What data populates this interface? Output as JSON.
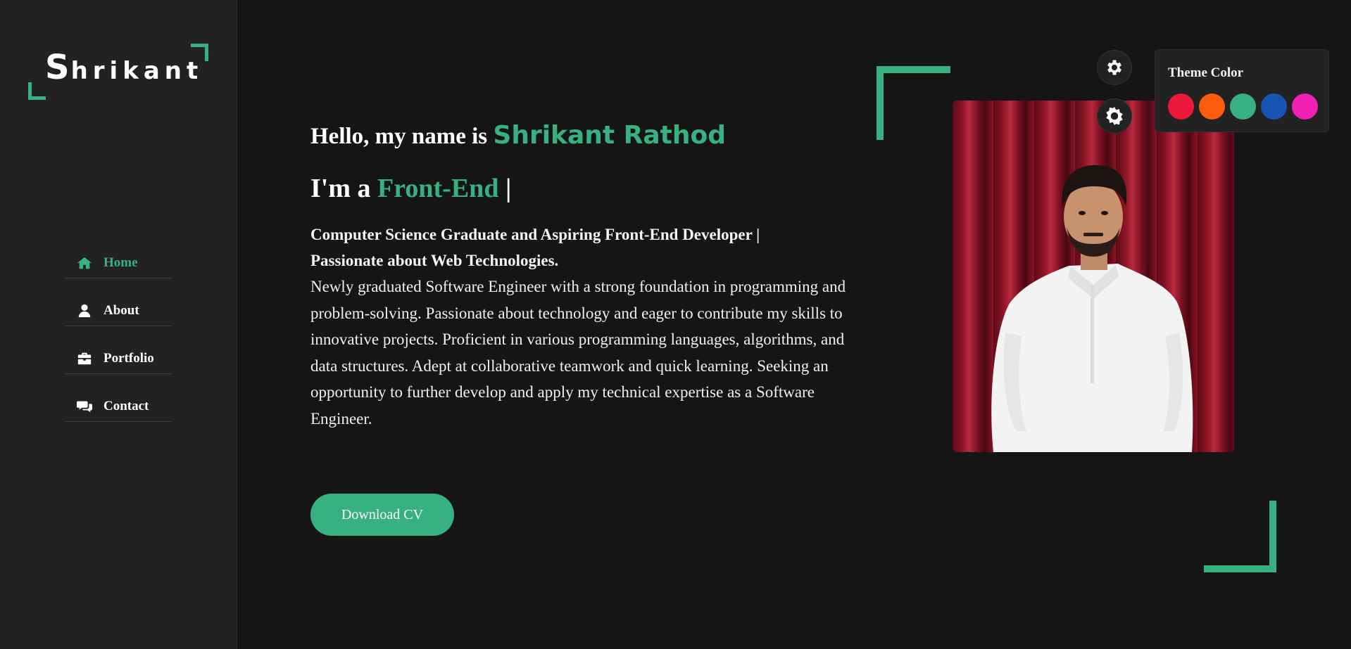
{
  "logo": {
    "first_letter": "S",
    "rest": "hrikant"
  },
  "nav": [
    {
      "label": "Home",
      "icon": "home-icon",
      "active": true
    },
    {
      "label": "About",
      "icon": "user-icon",
      "active": false
    },
    {
      "label": "Portfolio",
      "icon": "briefcase-icon",
      "active": false
    },
    {
      "label": "Contact",
      "icon": "chat-icon",
      "active": false
    }
  ],
  "hero": {
    "greeting_prefix": "Hello, my name is",
    "name": "Shrikant Rathod",
    "role_prefix": "I'm a",
    "role": "Front-End",
    "cursor": "|",
    "lead_line1": "Computer Science Graduate and Aspiring Front-End Developer |",
    "lead_line2": "Passionate about Web Technologies.",
    "description": "Newly graduated Software Engineer with a strong foundation in programming and problem-solving. Passionate about technology and eager to contribute my skills to innovative projects. Proficient in various programming languages, algorithms, and data structures. Adept at collaborative teamwork and quick learning. Seeking an opportunity to further develop and apply my technical expertise as a Software Engineer.",
    "cta_label": "Download CV"
  },
  "theme": {
    "title": "Theme Color",
    "accent": "#37b182",
    "colors": [
      "#ec1839",
      "#fa5b0f",
      "#37b182",
      "#1854b4",
      "#f021b2"
    ]
  },
  "icons": {
    "settings": "gear-icon",
    "day_night": "sun-gear-icon"
  }
}
